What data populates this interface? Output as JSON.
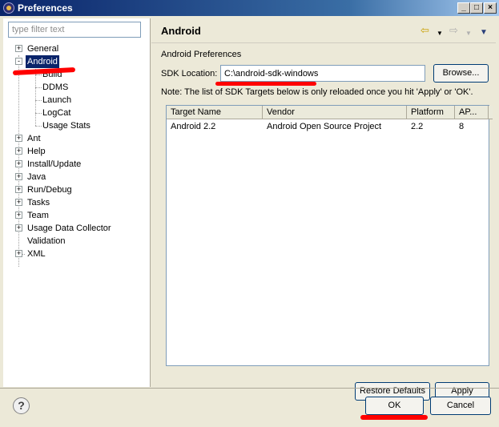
{
  "window": {
    "title": "Preferences"
  },
  "filter": {
    "placeholder": "type filter text"
  },
  "tree": [
    {
      "label": "General",
      "expander": "+"
    },
    {
      "label": "Android",
      "expander": "-"
    },
    {
      "label": "Build"
    },
    {
      "label": "DDMS"
    },
    {
      "label": "Launch"
    },
    {
      "label": "LogCat"
    },
    {
      "label": "Usage Stats"
    },
    {
      "label": "Ant",
      "expander": "+"
    },
    {
      "label": "Help",
      "expander": "+"
    },
    {
      "label": "Install/Update",
      "expander": "+"
    },
    {
      "label": "Java",
      "expander": "+"
    },
    {
      "label": "Run/Debug",
      "expander": "+"
    },
    {
      "label": "Tasks",
      "expander": "+"
    },
    {
      "label": "Team",
      "expander": "+"
    },
    {
      "label": "Usage Data Collector",
      "expander": "+"
    },
    {
      "label": "Validation"
    },
    {
      "label": "XML",
      "expander": "+"
    }
  ],
  "page": {
    "title": "Android",
    "section_title": "Android Preferences",
    "sdk_label": "SDK Location:",
    "sdk_value": "C:\\android-sdk-windows",
    "browse_label": "Browse...",
    "note": "Note: The list of SDK Targets below is only reloaded once you hit 'Apply' or 'OK'."
  },
  "targets": {
    "columns": [
      "Target Name",
      "Vendor",
      "Platform",
      "AP..."
    ],
    "rows": [
      [
        "Android 2.2",
        "Android Open Source Project",
        "2.2",
        "8"
      ]
    ]
  },
  "buttons": {
    "restore_defaults": "Restore Defaults",
    "apply": "Apply",
    "ok": "OK",
    "cancel": "Cancel",
    "help_glyph": "?"
  },
  "colors": {
    "title_bar": "#0a246a",
    "selection": "#0a246a",
    "annotation": "#ff0000"
  }
}
